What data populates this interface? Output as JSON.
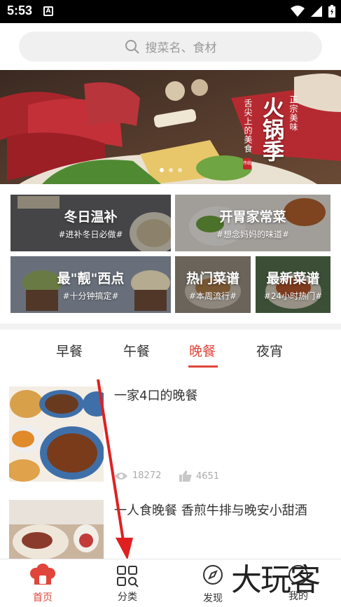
{
  "status_bar": {
    "time": "5:53",
    "notif_letter": "A"
  },
  "search": {
    "placeholder": "搜菜名、食材"
  },
  "banner": {
    "vertical_title": "火锅季",
    "vertical_sub_right": "正宗美味",
    "vertical_sub_left": "舌尖上的美食",
    "seal_text": "传统",
    "slides": 3,
    "active_slide": 1
  },
  "cards": [
    {
      "title": "冬日温补",
      "subtitle": "#进补冬日必做#"
    },
    {
      "title": "开胃家常菜",
      "subtitle": "#想念妈妈的味道#"
    },
    {
      "title": "最\"靓\"西点",
      "subtitle": "#十分钟搞定#"
    },
    {
      "title": "热门菜谱",
      "subtitle": "#本周流行#"
    },
    {
      "title": "最新菜谱",
      "subtitle": "#24小时热门#"
    }
  ],
  "tabs": [
    {
      "label": "早餐"
    },
    {
      "label": "午餐"
    },
    {
      "label": "晚餐",
      "active": true
    },
    {
      "label": "夜宵"
    }
  ],
  "recipes": [
    {
      "title": "一家4口的晚餐",
      "views": "18272",
      "likes": "4651"
    },
    {
      "title": "一人食晚餐 香煎牛排与晚安小甜酒"
    }
  ],
  "bottom_nav": [
    {
      "label": "首页",
      "active": true
    },
    {
      "label": "分类"
    },
    {
      "label": "发现"
    },
    {
      "label": "我的"
    }
  ],
  "watermark": "大玩客",
  "colors": {
    "accent": "#e0453b",
    "status_bar": "#000000",
    "search_bg": "#f0f0f0"
  }
}
